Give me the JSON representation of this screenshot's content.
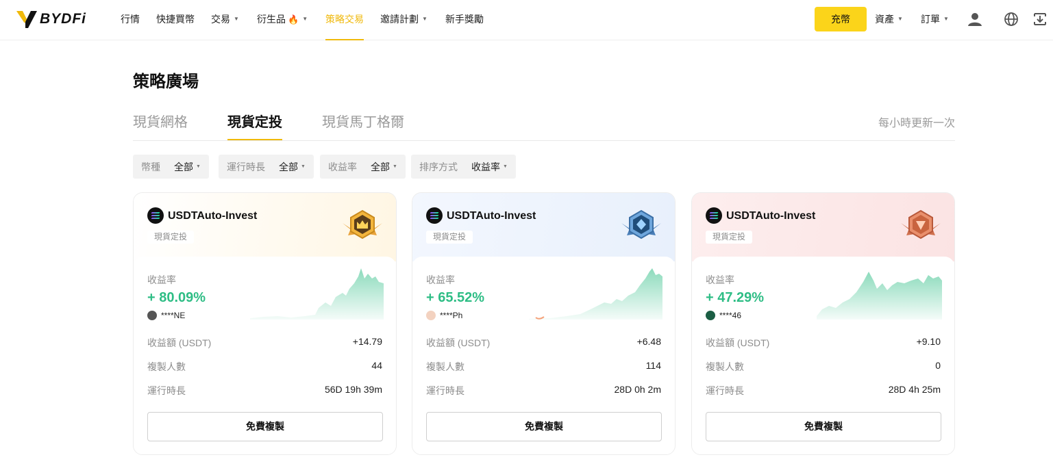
{
  "brand": {
    "name": "BYDFi",
    "accent": "#f0b90b",
    "deposit_color": "#fbd41a",
    "profit_color": "#2ebd85"
  },
  "nav": {
    "items": [
      {
        "label": "行情",
        "has_caret": false
      },
      {
        "label": "快捷買幣",
        "has_caret": false
      },
      {
        "label": "交易",
        "has_caret": true
      },
      {
        "label": "衍生品",
        "has_caret": true,
        "hot_icon": "fire-icon"
      },
      {
        "label": "策略交易",
        "has_caret": false,
        "active": true
      },
      {
        "label": "邀請計劃",
        "has_caret": true
      },
      {
        "label": "新手獎勵",
        "has_caret": false
      }
    ],
    "deposit_label": "充幣",
    "assets_label": "資產",
    "orders_label": "訂單",
    "icons": [
      "user-icon",
      "globe-icon",
      "download-icon"
    ]
  },
  "page": {
    "title": "策略廣場",
    "tabs": [
      "現貨網格",
      "現貨定投",
      "現貨馬丁格爾"
    ],
    "active_tab": "現貨定投",
    "update_note": "每小時更新一次"
  },
  "filters": [
    {
      "label": "幣種",
      "value": "全部"
    },
    {
      "label": "運行時長",
      "value": "全部"
    },
    {
      "label": "收益率",
      "value": "全部"
    },
    {
      "label": "排序方式",
      "value": "收益率"
    }
  ],
  "cards": [
    {
      "name": "USDTAuto-Invest",
      "tag": "現貨定投",
      "badge": "gold-crown-badge-icon",
      "roi_label": "收益率",
      "roi": "+ 80.09%",
      "owner": "****NE",
      "rows": [
        {
          "label": "收益額 (USDT)",
          "value": "+14.79"
        },
        {
          "label": "複製人數",
          "value": "44"
        },
        {
          "label": "運行時長",
          "value": "56D 19h 39m"
        }
      ],
      "copy_label": "免費複製"
    },
    {
      "name": "USDTAuto-Invest",
      "tag": "現貨定投",
      "badge": "blue-diamond-badge-icon",
      "roi_label": "收益率",
      "roi": "+ 65.52%",
      "owner": "****Ph",
      "rows": [
        {
          "label": "收益額 (USDT)",
          "value": "+6.48"
        },
        {
          "label": "複製人數",
          "value": "114"
        },
        {
          "label": "運行時長",
          "value": "28D 0h 2m"
        }
      ],
      "copy_label": "免費複製"
    },
    {
      "name": "USDTAuto-Invest",
      "tag": "現貨定投",
      "badge": "bronze-shield-badge-icon",
      "roi_label": "收益率",
      "roi": "+ 47.29%",
      "owner": "****46",
      "rows": [
        {
          "label": "收益額 (USDT)",
          "value": "+9.10"
        },
        {
          "label": "複製人數",
          "value": "0"
        },
        {
          "label": "運行時長",
          "value": "28D 4h 25m"
        }
      ],
      "copy_label": "免費複製"
    }
  ]
}
